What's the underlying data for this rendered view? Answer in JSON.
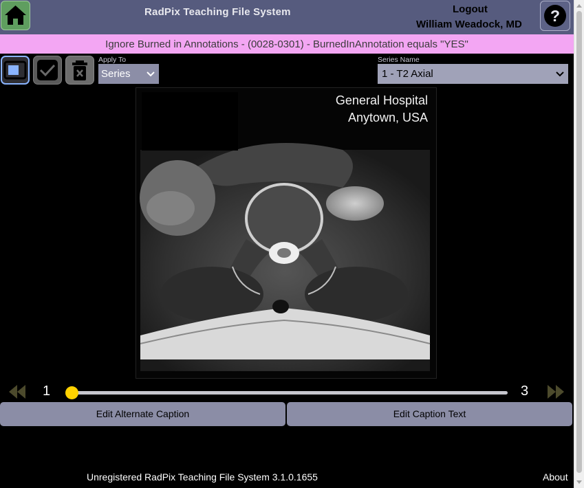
{
  "header": {
    "title": "RadPix Teaching File System",
    "logout": "Logout",
    "username": "William Weadock, MD",
    "home_icon": "home-icon",
    "help_icon": "question-icon"
  },
  "banner": {
    "text": "Ignore Burned in Annotations - (0028-0301) - BurnedInAnnotation equals \"YES\""
  },
  "toolbar": {
    "icons": [
      "single-view-icon",
      "checkmark-icon",
      "trash-icon"
    ],
    "apply_to_label": "Apply To",
    "apply_to_value": "Series",
    "series_name_label": "Series Name",
    "series_name_value": "1 - T2 Axial"
  },
  "image": {
    "overlay_line1": "General Hospital",
    "overlay_line2": "Anytown, USA"
  },
  "slider": {
    "first": "1",
    "last": "3",
    "position": 0
  },
  "buttons": {
    "edit_alternate_caption": "Edit Alternate Caption",
    "edit_caption_text": "Edit Caption Text"
  },
  "footer": {
    "status": "Unregistered RadPix Teaching File System 3.1.0.1655",
    "about": "About"
  },
  "colors": {
    "header_bg": "#565b7e",
    "banner_bg": "#f3a6f3",
    "knob": "#ffd200",
    "button_bg": "#8b8da6"
  }
}
